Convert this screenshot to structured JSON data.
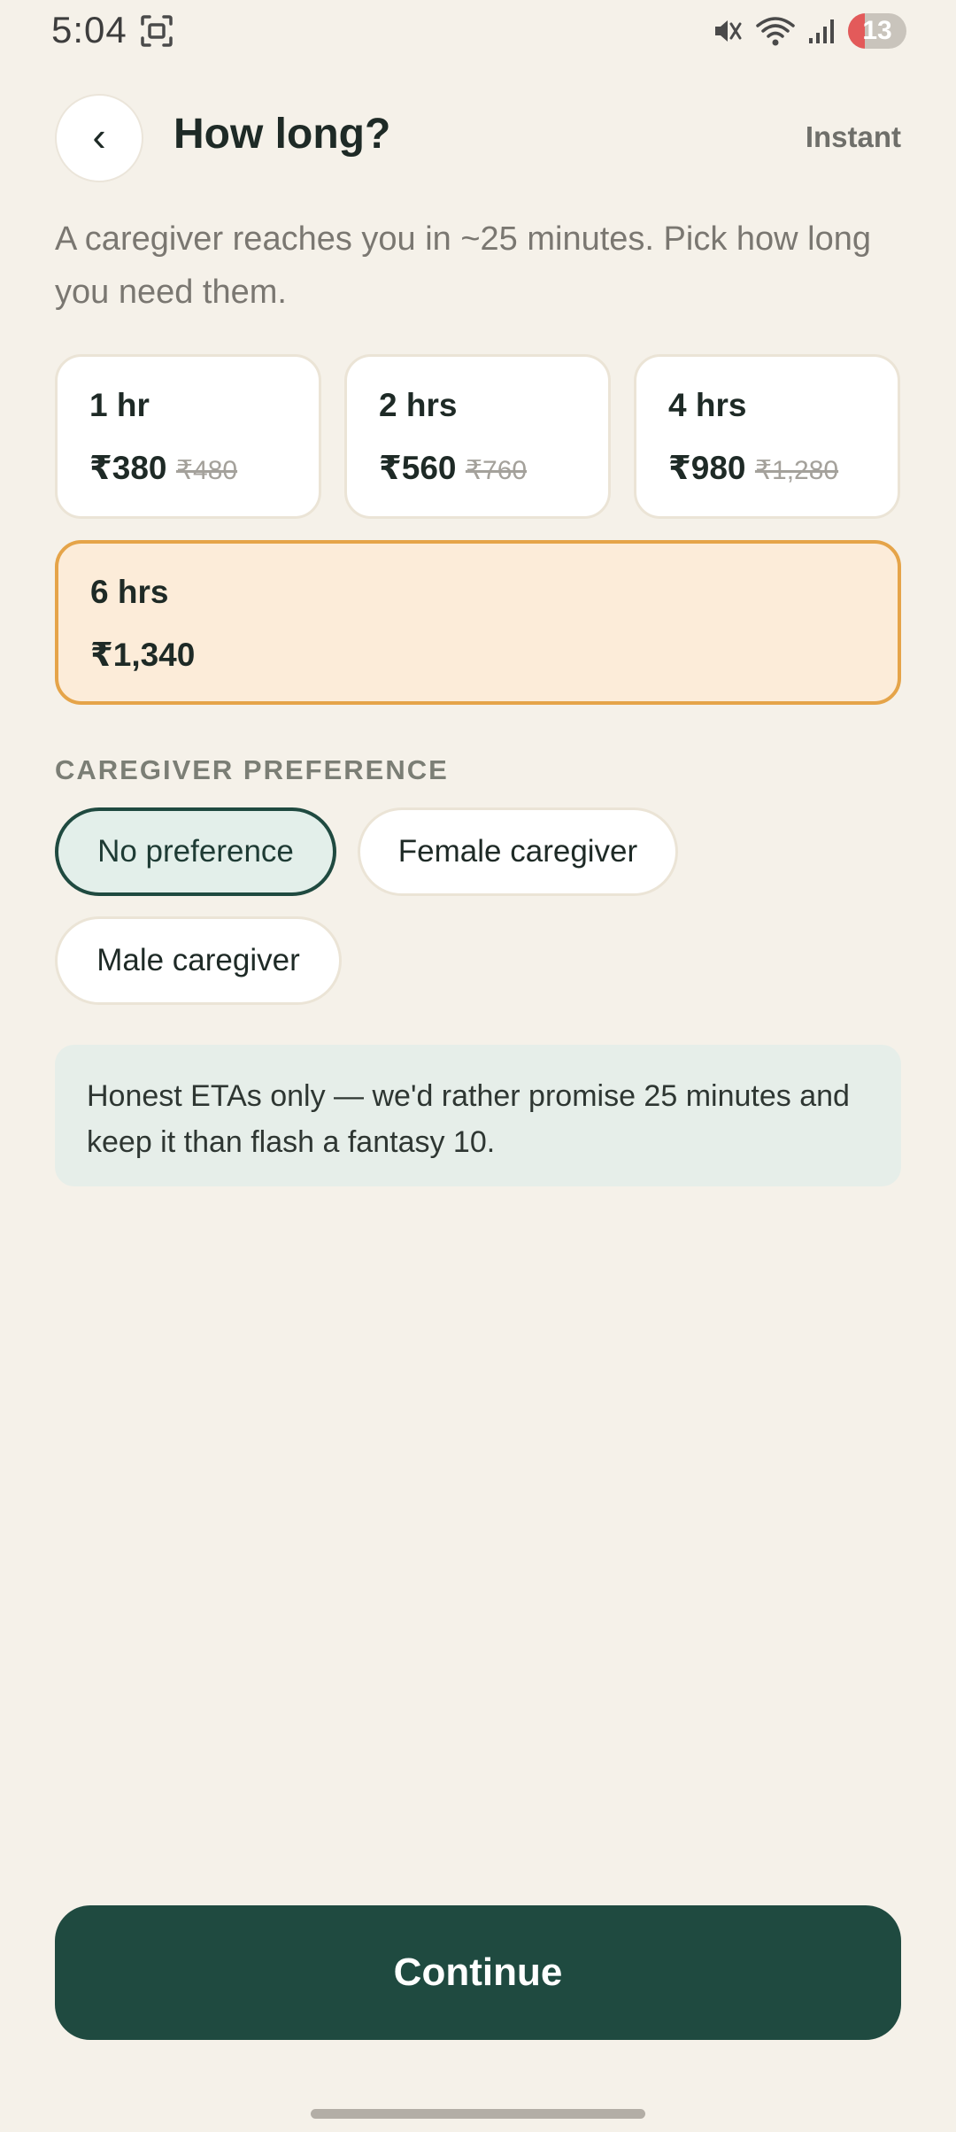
{
  "status_bar": {
    "time": "5:04",
    "battery_level": "13",
    "battery_fraction": 0.13,
    "icons": [
      "screen-record-icon",
      "mute-icon",
      "wifi-icon",
      "signal-icon",
      "battery-icon"
    ],
    "battery_color": "#e35a5a"
  },
  "header": {
    "back_glyph": "‹",
    "title": "How long?",
    "mode": "Instant"
  },
  "subtitle": "A caregiver reaches you in ~25 minutes. Pick how long you need them.",
  "durations": [
    {
      "label": "1 hr",
      "price": "₹380",
      "old_price": "₹480",
      "selected": false
    },
    {
      "label": "2 hrs",
      "price": "₹560",
      "old_price": "₹760",
      "selected": false
    },
    {
      "label": "4 hrs",
      "price": "₹980",
      "old_price": "₹1,280",
      "selected": false
    },
    {
      "label": "6 hrs",
      "price": "₹1,340",
      "old_price": "",
      "selected": true
    }
  ],
  "preference": {
    "section_label": "CAREGIVER PREFERENCE",
    "options": [
      {
        "label": "No preference",
        "selected": true
      },
      {
        "label": "Female caregiver",
        "selected": false
      },
      {
        "label": "Male caregiver",
        "selected": false
      }
    ]
  },
  "note": "Honest ETAs only — we'd rather promise 25 minutes and keep it than flash a fantasy 10.",
  "continue_label": "Continue",
  "colors": {
    "background": "#f5f1e9",
    "primary": "#1f4a40",
    "selected_card_bg": "#fcecd9",
    "selected_card_border": "#e5a449",
    "selected_chip_bg": "#e3efea",
    "note_bg": "#e6eee9"
  }
}
